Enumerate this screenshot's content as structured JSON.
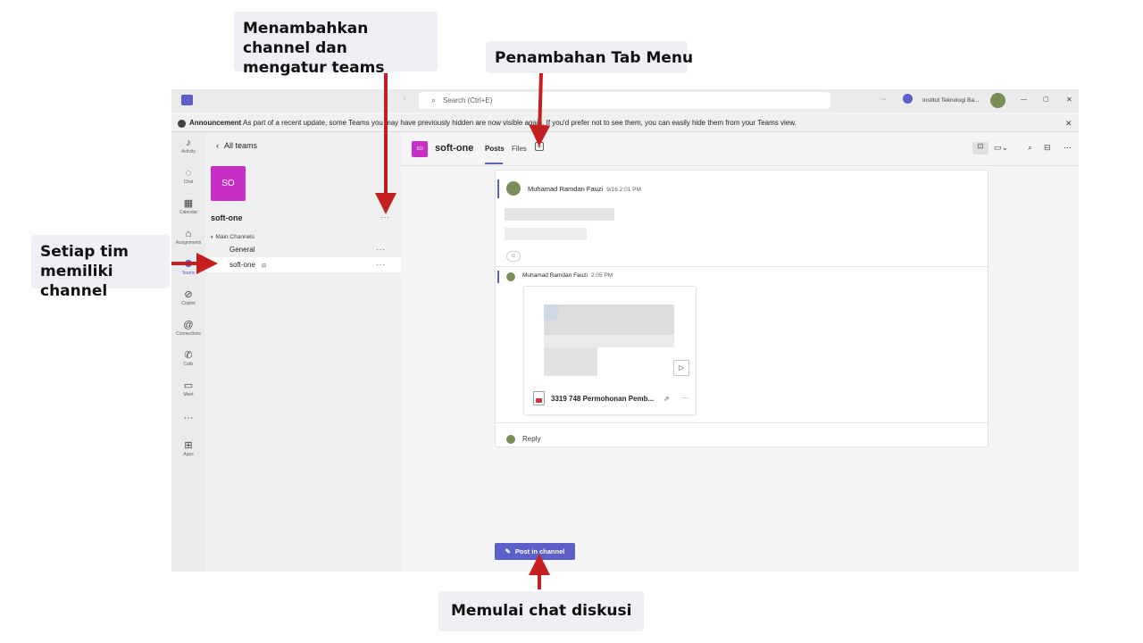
{
  "callouts": {
    "top_left": "Menambahkan channel dan mengatur teams",
    "top_right": "Penambahan Tab Menu",
    "left": "Setiap tim memiliki channel",
    "bottom": "Memulai chat diskusi"
  },
  "titlebar": {
    "search_placeholder": "Search (Ctrl+E)",
    "org_name": "Institut Teknologi Ba...",
    "more": "···",
    "minimize": "—",
    "restore": "▢",
    "close": "✕"
  },
  "announcement": {
    "label": "Announcement",
    "text": "As part of a recent update, some Teams you may have previously hidden are now visible again. If you'd prefer not to see them, you can easily hide them from your Teams view.",
    "close": "✕"
  },
  "rail": {
    "items": [
      {
        "label": "Activity",
        "icon": "bell-icon"
      },
      {
        "label": "Chat",
        "icon": "chat-icon"
      },
      {
        "label": "Calendar",
        "icon": "calendar-icon"
      },
      {
        "label": "Assignments",
        "icon": "assignments-icon"
      },
      {
        "label": "Teams",
        "icon": "teams-icon"
      },
      {
        "label": "Copilot",
        "icon": "copilot-icon"
      },
      {
        "label": "Connections",
        "icon": "connections-icon"
      },
      {
        "label": "Calls",
        "icon": "phone-icon"
      },
      {
        "label": "Meet",
        "icon": "video-icon"
      },
      {
        "label": "",
        "icon": "more-icon"
      },
      {
        "label": "Apps",
        "icon": "apps-icon"
      }
    ]
  },
  "sidebar": {
    "back_label": "All teams",
    "team_initials": "SO",
    "team_name": "soft-one",
    "section_label": "Main Channels",
    "channels": [
      {
        "name": "General"
      },
      {
        "name": "soft-one"
      }
    ],
    "more": "···"
  },
  "channel_header": {
    "initials": "SO",
    "title": "soft-one",
    "tabs": [
      "Posts",
      "Files"
    ],
    "add_tab": "+"
  },
  "posts": [
    {
      "author": "Muhamad Ramdan Fauzi",
      "time": "9/16 2:01 PM"
    },
    {
      "author": "Muhamad Ramdan Fauzi",
      "time": "2:05 PM"
    }
  ],
  "attachment": {
    "file_name": "3319 748 Permohonan Pemb...",
    "more": "···"
  },
  "reply_label": "Reply",
  "post_button": "Post in channel",
  "colors": {
    "accent": "#5b5fc7",
    "team_avatar": "#c82fc4",
    "arrow": "#c41e1e"
  }
}
